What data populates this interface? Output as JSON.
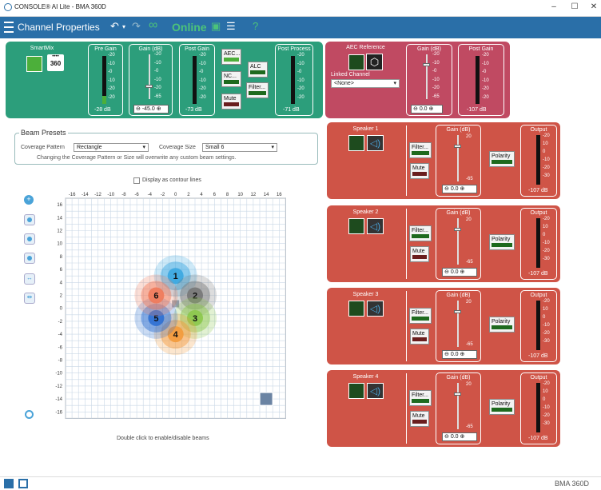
{
  "window": {
    "title": "CONSOLE® AI Lite - BMA 360D",
    "min": "–",
    "max": "☐",
    "close": "✕"
  },
  "toolbar": {
    "title": "Channel Properties",
    "online": "Online",
    "help": "?"
  },
  "smartmix": {
    "label": "SmartMix",
    "badge_top": "••••",
    "badge_num": "360"
  },
  "pregain": {
    "label": "Pre Gain",
    "value": "-28 dB"
  },
  "gain": {
    "label": "Gain (dB)",
    "value": "-45.0"
  },
  "postgain": {
    "label": "Post Gain",
    "value": "-73 dB"
  },
  "channel_buttons": {
    "aec": "AEC...",
    "nc": "NC...",
    "mute": "Mute",
    "alc": "ALC",
    "filter": "Filter..."
  },
  "postprocess": {
    "label": "Post Process",
    "value": "-71 dB"
  },
  "aec_ref": {
    "label": "AEC Reference",
    "linked_label": "Linked Channel",
    "linked_value": "<None>",
    "gain_label": "Gain (dB)",
    "gain_value": "0.0",
    "post_label": "Post Gain",
    "post_value": "-107 dB"
  },
  "scale_meter": [
    "-20",
    "-10",
    "-0",
    "-10",
    "-20"
  ],
  "scale_gain": [
    "-20",
    "-10",
    "-0",
    "-10",
    "-20",
    "-65"
  ],
  "scale_output": [
    "-20",
    "10",
    "0",
    "-10",
    "-20",
    "-30"
  ],
  "speakers": [
    {
      "label": "Speaker 1",
      "filter": "Filter...",
      "mute": "Mute",
      "gain_label": "Gain (dB)",
      "gain_value": "0.0",
      "gain_min": "-65",
      "gain_max": "20",
      "polarity": "Polarity",
      "output_label": "Output",
      "output_value": "-107 dB"
    },
    {
      "label": "Speaker 2",
      "filter": "Filter...",
      "mute": "Mute",
      "gain_label": "Gain (dB)",
      "gain_value": "0.0",
      "gain_min": "-65",
      "gain_max": "20",
      "polarity": "Polarity",
      "output_label": "Output",
      "output_value": "-107 dB"
    },
    {
      "label": "Speaker 3",
      "filter": "Filter...",
      "mute": "Mute",
      "gain_label": "Gain (dB)",
      "gain_value": "0.0",
      "gain_min": "-65",
      "gain_max": "20",
      "polarity": "Polarity",
      "output_label": "Output",
      "output_value": "-107 dB"
    },
    {
      "label": "Speaker 4",
      "filter": "Filter...",
      "mute": "Mute",
      "gain_label": "Gain (dB)",
      "gain_value": "0.0",
      "gain_min": "-65",
      "gain_max": "20",
      "polarity": "Polarity",
      "output_label": "Output",
      "output_value": "-107 dB"
    }
  ],
  "beam_presets": {
    "legend": "Beam Presets",
    "coverage_pattern_label": "Coverage Pattern",
    "coverage_pattern_value": "Rectangle",
    "coverage_size_label": "Coverage Size",
    "coverage_size_value": "Small 6",
    "warning": "Changing the Coverage Pattern or Size will overwrite any custom beam settings."
  },
  "contour": {
    "label": "Display as contour lines"
  },
  "grid": {
    "x_ticks": [
      "-16",
      "-14",
      "-12",
      "-10",
      "-8",
      "-6",
      "-4",
      "-2",
      "0",
      "2",
      "4",
      "6",
      "8",
      "10",
      "12",
      "14",
      "16"
    ],
    "y_ticks": [
      "16",
      "14",
      "12",
      "10",
      "8",
      "6",
      "4",
      "2",
      "0",
      "-2",
      "-4",
      "-6",
      "-8",
      "-10",
      "-12",
      "-14",
      "-16"
    ],
    "hint": "Double click to enable/disable beams",
    "beams": [
      {
        "num": "1",
        "x": 0,
        "y": 5,
        "color": "#3aa7e0"
      },
      {
        "num": "2",
        "x": 3,
        "y": 2,
        "color": "#777777"
      },
      {
        "num": "3",
        "x": 3,
        "y": -1.5,
        "color": "#8cc84b"
      },
      {
        "num": "4",
        "x": 0,
        "y": -4,
        "color": "#f39a3b"
      },
      {
        "num": "5",
        "x": -3,
        "y": -1.5,
        "color": "#2d6fd1"
      },
      {
        "num": "6",
        "x": -3,
        "y": 2,
        "color": "#f07a5a"
      }
    ]
  },
  "status": {
    "device": "BMA 360D"
  }
}
